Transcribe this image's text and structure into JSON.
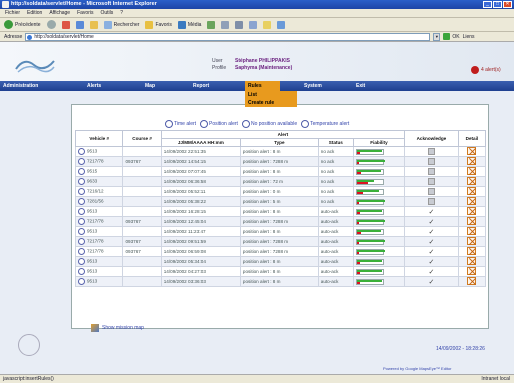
{
  "window": {
    "title": "http://soldata/servlet/Home - Microsoft Internet Explorer"
  },
  "menubar": [
    "Fichier",
    "Edition",
    "Affichage",
    "Favoris",
    "Outils",
    "?"
  ],
  "toolbar": {
    "back": "Précédente",
    "search": "Rechercher",
    "favorites": "Favoris",
    "media": "Média"
  },
  "addressbar": {
    "label": "Adresse",
    "url": "http://soldata/servlet/Home",
    "go": "OK",
    "links": "Liens"
  },
  "user": {
    "user_label": "User",
    "user_value": "Stéphane PHILIPPAKIS",
    "profile_label": "Profile",
    "profile_value": "Saphyma (Maintenance)"
  },
  "alerts_link": "4 alert(s)",
  "nav": [
    "Administration",
    "Alerts",
    "Map",
    "Report",
    "Rules",
    "System",
    "Exit"
  ],
  "rules_menu": [
    "List",
    "Create rule"
  ],
  "legend": [
    "Time alert",
    "Position alert",
    "No position available",
    "Temperature alert"
  ],
  "panel": {
    "title": "Alert"
  },
  "table": {
    "headers": [
      "Vehicle #",
      "Course #",
      "Alert",
      "Acknowledge",
      "Detail"
    ],
    "sub_headers": [
      "JJ/MM/AAAA HH:mm",
      "Type",
      "Status",
      "Fiability"
    ],
    "rows": [
      {
        "vehicle": "9513",
        "course": "",
        "datetime": "14/09/2002 22:51:35",
        "type": "position alert : 8 m",
        "status": "no ack",
        "fiability": 0.9,
        "ack": "box"
      },
      {
        "vehicle": "7217/78",
        "course": "093767",
        "datetime": "14/09/2002 14:54:15",
        "type": "position alert : 7288 m",
        "status": "no ack",
        "fiability": 1.0,
        "ack": "box"
      },
      {
        "vehicle": "9515",
        "course": "",
        "datetime": "14/09/2002 07:07:45",
        "type": "position alert : 8 m",
        "status": "no ack",
        "fiability": 0.85,
        "ack": "box"
      },
      {
        "vehicle": "9633",
        "course": "",
        "datetime": "14/09/2002 06:36:58",
        "type": "position alert : 72 m",
        "status": "no ack",
        "fiability": 0.6,
        "ack": "box"
      },
      {
        "vehicle": "7216/12",
        "course": "",
        "datetime": "14/09/2002 05:52:11",
        "type": "position alert : 0 m",
        "status": "no ack",
        "fiability": 0.8,
        "ack": "box"
      },
      {
        "vehicle": "7281/56",
        "course": "",
        "datetime": "14/09/2002 05:38:22",
        "type": "position alert : 5 m",
        "status": "no ack",
        "fiability": 1.0,
        "ack": "box"
      },
      {
        "vehicle": "9513",
        "course": "",
        "datetime": "14/09/2002 16:28:15",
        "type": "position alert : 8 m",
        "status": "auto-ack",
        "fiability": 0.9,
        "ack": "check"
      },
      {
        "vehicle": "7217/78",
        "course": "093767",
        "datetime": "14/09/2002 12:45:04",
        "type": "position alert : 7288 m",
        "status": "auto-ack",
        "fiability": 1.0,
        "ack": "check"
      },
      {
        "vehicle": "9513",
        "course": "",
        "datetime": "14/09/2002 11:23:47",
        "type": "position alert : 8 m",
        "status": "auto-ack",
        "fiability": 0.85,
        "ack": "check"
      },
      {
        "vehicle": "7217/78",
        "course": "093767",
        "datetime": "14/09/2002 09:51:59",
        "type": "position alert : 7288 m",
        "status": "auto-ack",
        "fiability": 1.0,
        "ack": "check"
      },
      {
        "vehicle": "7217/78",
        "course": "093767",
        "datetime": "14/09/2002 06:59:08",
        "type": "position alert : 7288 m",
        "status": "auto-ack",
        "fiability": 1.0,
        "ack": "check"
      },
      {
        "vehicle": "9513",
        "course": "",
        "datetime": "14/09/2002 05:34:04",
        "type": "position alert : 8 m",
        "status": "auto-ack",
        "fiability": 0.9,
        "ack": "check"
      },
      {
        "vehicle": "9513",
        "course": "",
        "datetime": "14/09/2002 04:27:03",
        "type": "position alert : 8 m",
        "status": "auto-ack",
        "fiability": 0.9,
        "ack": "check"
      },
      {
        "vehicle": "9513",
        "course": "",
        "datetime": "14/09/2002 03:36:03",
        "type": "position alert : 8 m",
        "status": "auto-ack",
        "fiability": 0.9,
        "ack": "check"
      }
    ]
  },
  "show_map": "Show mission map",
  "footer": {
    "datetime": "14/09/2002 - 18:28:26",
    "powered": "Powered by Google MapsEye™ Editor"
  },
  "statusbar": {
    "left": "javascript:insertRules()",
    "zone": "Intranet local"
  }
}
